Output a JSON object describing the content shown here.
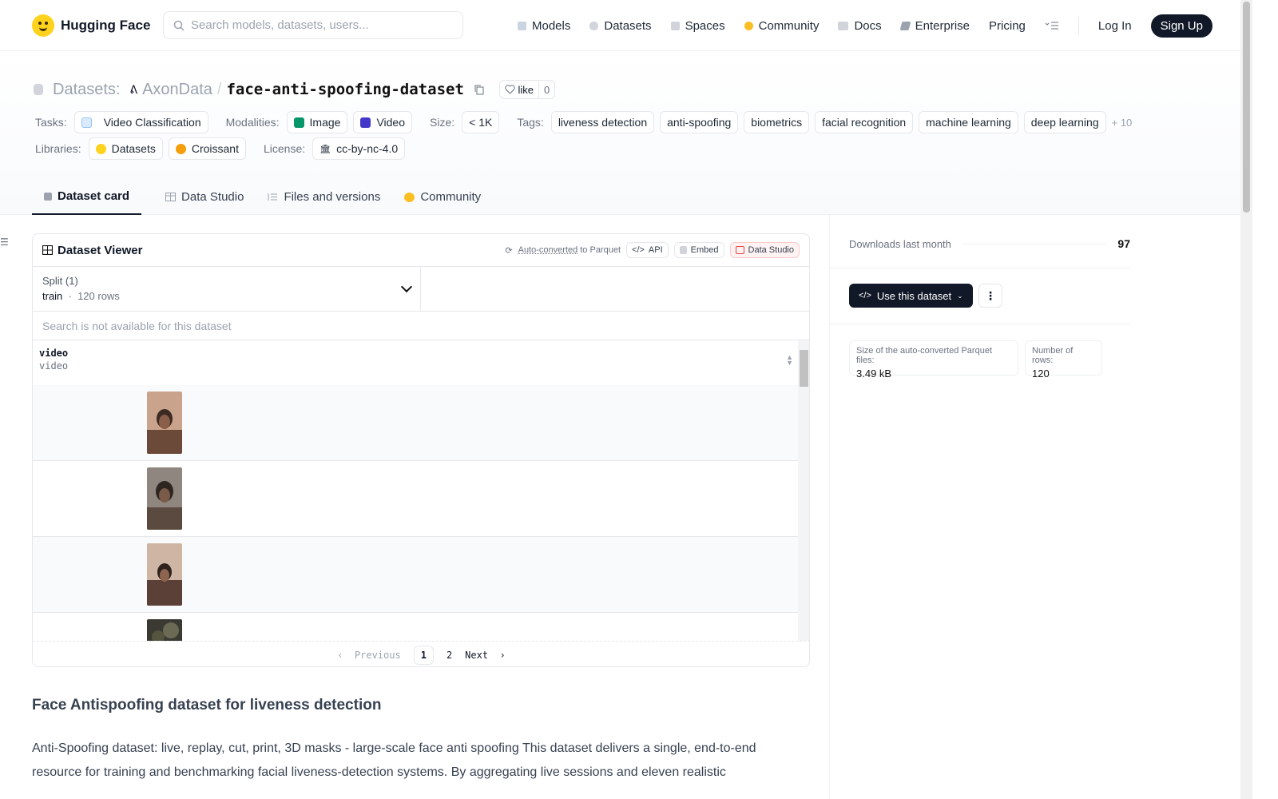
{
  "brand": {
    "name": "Hugging Face"
  },
  "search": {
    "placeholder": "Search models, datasets, users..."
  },
  "nav": {
    "links": [
      {
        "label": "Models",
        "icon": "models-icon",
        "color": "#9ca3af"
      },
      {
        "label": "Datasets",
        "icon": "datasets-icon",
        "color": "#9ca3af"
      },
      {
        "label": "Spaces",
        "icon": "spaces-icon",
        "color": "#9ca3af"
      },
      {
        "label": "Community",
        "icon": "community-icon",
        "color": "#fbbf24"
      },
      {
        "label": "Docs",
        "icon": "docs-icon",
        "color": "#9ca3af"
      },
      {
        "label": "Enterprise",
        "icon": "enterprise-icon",
        "color": "#6b7280"
      },
      {
        "label": "Pricing"
      }
    ],
    "login": "Log In",
    "signup": "Sign Up"
  },
  "repo": {
    "type_label": "Datasets:",
    "owner": "AxonData",
    "separator": "/",
    "name": "face-anti-spoofing-dataset",
    "like_label": "like",
    "like_count": "0"
  },
  "meta": {
    "tasks_label": "Tasks:",
    "tasks": [
      "Video Classification"
    ],
    "modalities_label": "Modalities:",
    "modalities": [
      "Image",
      "Video"
    ],
    "size_label": "Size:",
    "size": "< 1K",
    "tags_label": "Tags:",
    "tags": [
      "liveness detection",
      "anti-spoofing",
      "biometrics",
      "facial recognition",
      "machine learning",
      "deep learning"
    ],
    "tags_more": "+ 10",
    "libraries_label": "Libraries:",
    "libraries": [
      "Datasets",
      "Croissant"
    ],
    "license_label": "License:",
    "license": "cc-by-nc-4.0"
  },
  "tabs": [
    "Dataset card",
    "Data Studio",
    "Files and versions",
    "Community"
  ],
  "viewer": {
    "title": "Dataset Viewer",
    "autoconverted": "Auto-converted",
    "to_parquet": "to Parquet",
    "api": "API",
    "embed": "Embed",
    "data_studio": "Data Studio",
    "split_label": "Split (1)",
    "split_name": "train",
    "split_rows": "120 rows",
    "search_disabled": "Search is not available for this dataset",
    "column_name": "video",
    "column_type": "video",
    "pager": {
      "previous": "Previous",
      "pages": [
        "1",
        "2"
      ],
      "next": "Next"
    }
  },
  "sidebar": {
    "downloads_label": "Downloads last month",
    "downloads": "97",
    "use_button": "Use this dataset",
    "parquet_size_label": "Size of the auto-converted Parquet files:",
    "parquet_size": "3.49 kB",
    "rows_label": "Number of rows:",
    "rows": "120"
  },
  "readme": {
    "heading": "Face Antispoofing dataset for liveness detection",
    "paragraph": "Anti-Spoofing dataset: live, replay, cut, print, 3D masks - large-scale face anti spoofing This dataset delivers a single, end-to-end resource for training and benchmarking facial liveness-detection systems. By aggregating live sessions and eleven realistic"
  }
}
